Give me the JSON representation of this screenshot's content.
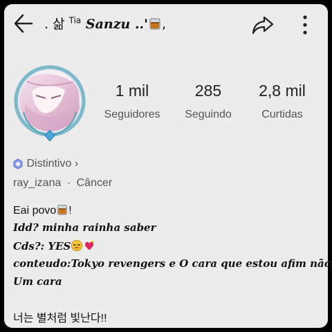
{
  "header": {
    "title_prefix": ". 삶 ",
    "title_superscript": "Tia",
    "title_name": " Sanzu ..'",
    "title_suffix": ","
  },
  "stats": [
    {
      "value": "1 mil",
      "label": "Seguidores"
    },
    {
      "value": "285",
      "label": "Seguindo"
    },
    {
      "value": "2,8 mil",
      "label": "Curtidas"
    }
  ],
  "badge": {
    "label": "Distintivo",
    "chevron": "›"
  },
  "meta": {
    "username": "ray_izana",
    "separator": "·",
    "sign": "Câncer"
  },
  "bio": {
    "line1": "Eai povo",
    "line1_end": "!",
    "line2": "Idd? minha rainha saber",
    "line3": "Cds?: YES",
    "line4": "conteudo:Tokyo revengers e O cara que estou afim não e",
    "line5": "Um cara",
    "line6": "너는 별처럼 빛난다!!"
  },
  "icons": {
    "back": "arrow-left-icon",
    "share": "share-arrow-icon",
    "more": "more-vertical-icon",
    "drink": "whiskey-glass-icon",
    "badge": "badge-icon"
  },
  "colors": {
    "background": "#ececec",
    "text": "#111111",
    "muted": "#555555",
    "badge": "#6a5acd",
    "ring": "#7fb8c8"
  }
}
